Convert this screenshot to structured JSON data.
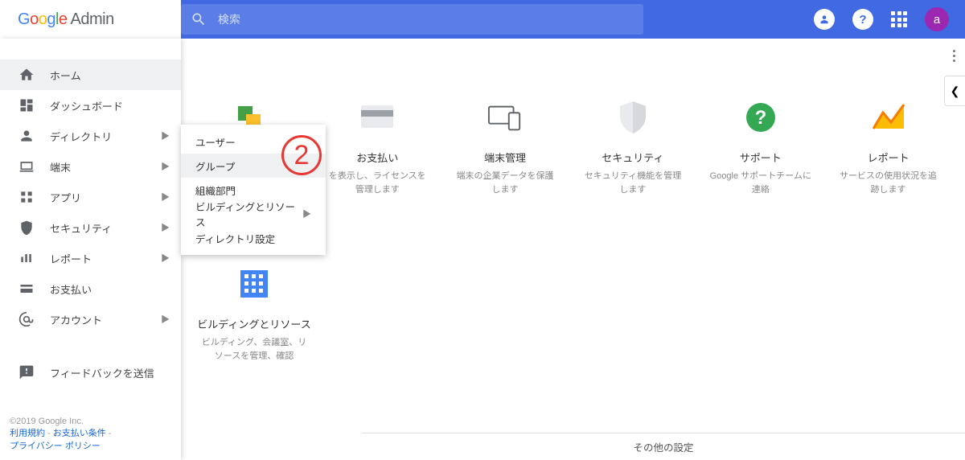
{
  "header": {
    "logo_admin": "Admin",
    "search_placeholder": "検索",
    "avatar_letter": "a"
  },
  "sidebar": {
    "items": [
      {
        "label": "ホーム"
      },
      {
        "label": "ダッシュボード"
      },
      {
        "label": "ディレクトリ"
      },
      {
        "label": "端末"
      },
      {
        "label": "アプリ"
      },
      {
        "label": "セキュリティ"
      },
      {
        "label": "レポート"
      },
      {
        "label": "お支払い"
      },
      {
        "label": "アカウント"
      }
    ],
    "feedback": "フィードバックを送信"
  },
  "footer": {
    "copyright": "©2019 Google Inc.",
    "link1": "利用規約",
    "link2": "お支払い条件",
    "link3": "プライバシー ポリシー",
    "sep": " - "
  },
  "submenu": {
    "items": [
      {
        "label": "ユーザー"
      },
      {
        "label": "グループ"
      },
      {
        "label": "組織部門"
      },
      {
        "label": "ビルディングとリソース"
      },
      {
        "label": "ディレクトリ設定"
      }
    ]
  },
  "cards": [
    {
      "title": "",
      "desc": ""
    },
    {
      "title": "お支払い",
      "desc": "を表示し、ライセンスを管理します"
    },
    {
      "title": "端末管理",
      "desc": "端末の企業データを保護します"
    },
    {
      "title": "セキュリティ",
      "desc": "セキュリティ機能を管理します"
    },
    {
      "title": "サポート",
      "desc": "Google サポートチームに連絡"
    },
    {
      "title": "レポート",
      "desc": "サービスの使用状況を追跡します"
    }
  ],
  "card_row2": {
    "title": "ビルディングとリソース",
    "desc": "ビルディング、会議室、リソースを管理、確認"
  },
  "bottom": "その他の設定",
  "annotation": "2"
}
